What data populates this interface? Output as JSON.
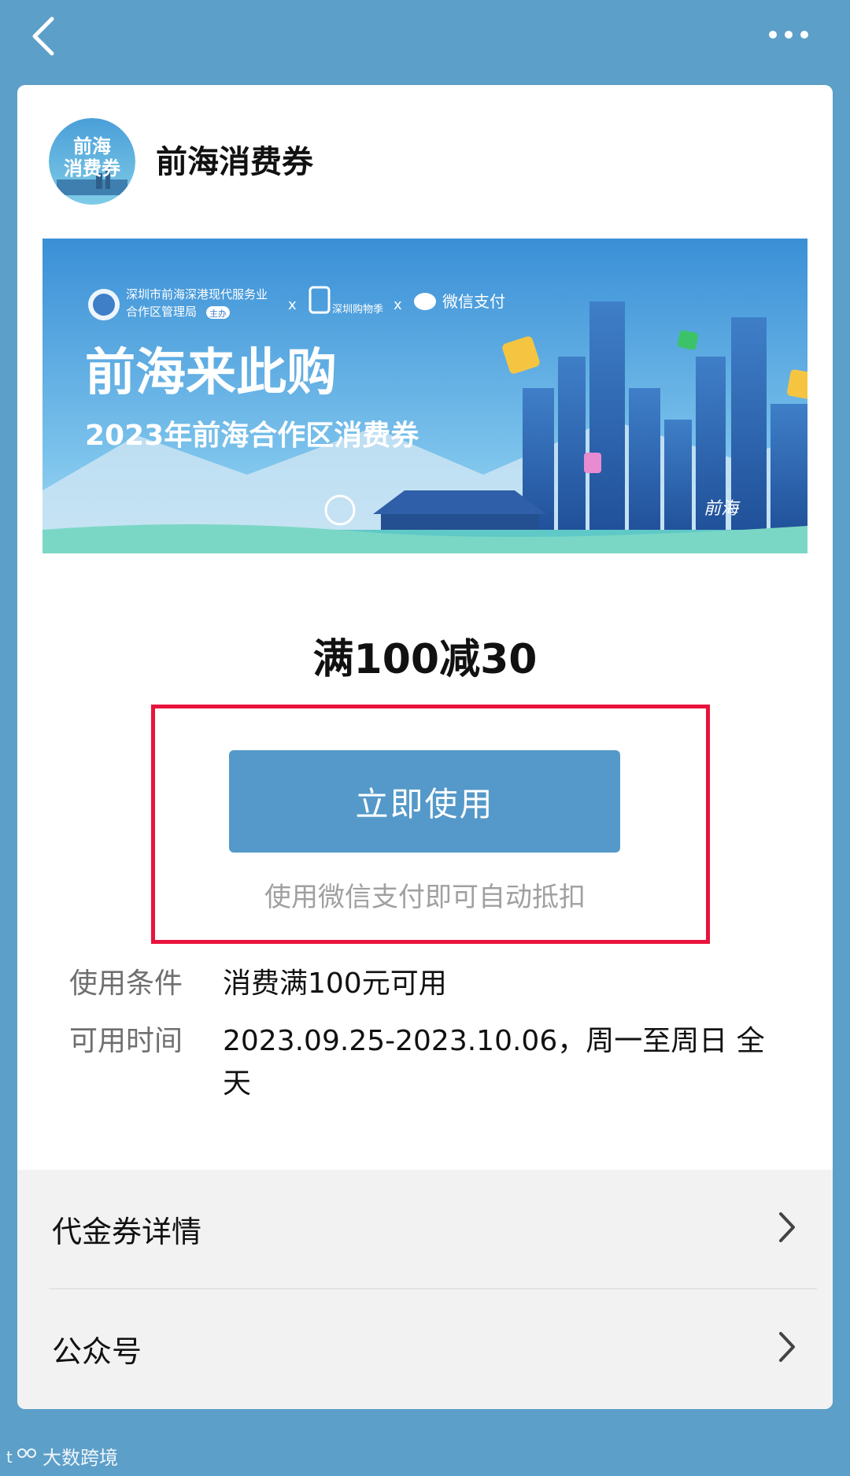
{
  "nav": {
    "back_icon": "chevron-left-icon",
    "more_icon": "more-dots-icon"
  },
  "card": {
    "title": "前海消费券",
    "logo_text_line1": "前海",
    "logo_text_line2": "消费券",
    "banner": {
      "org1_line1": "深圳市前海深港现代服务业",
      "org1_line2": "合作区管理局",
      "org1_badge": "主办",
      "sep": "x",
      "org2": "深圳购物季",
      "org3": "微信支付",
      "headline": "前海来此购",
      "subheadline": "2023年前海合作区消费券",
      "signature": "前海"
    },
    "amount": "满100减30",
    "use_button": "立即使用",
    "hint": "使用微信支付即可自动抵扣",
    "conditions": [
      {
        "label": "使用条件",
        "value": "消费满100元可用"
      },
      {
        "label": "可用时间",
        "value": "2023.09.25-2023.10.06，周一至周日 全天"
      }
    ],
    "rows": [
      {
        "label": "代金券详情"
      },
      {
        "label": "公众号"
      }
    ]
  },
  "watermark": "大数跨境",
  "colors": {
    "background": "#5c9fc9",
    "button": "#5499c9",
    "highlight": "#e8123c"
  }
}
